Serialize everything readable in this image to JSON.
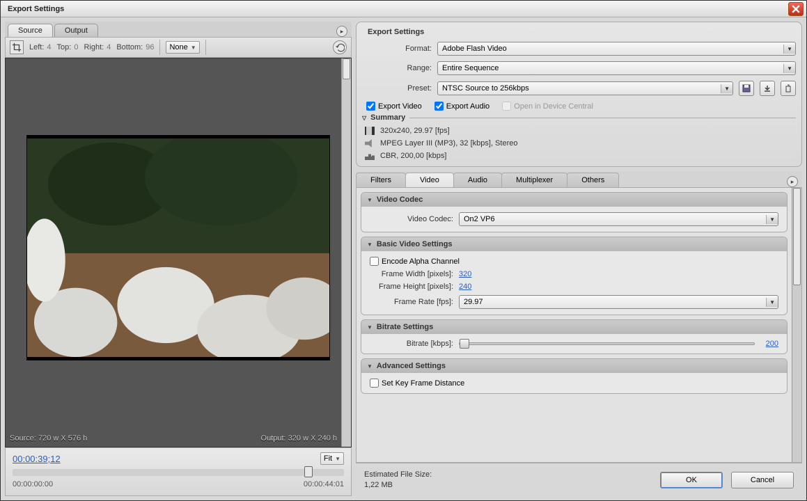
{
  "window": {
    "title": "Export Settings"
  },
  "leftTabs": {
    "source": "Source",
    "output": "Output"
  },
  "crop": {
    "leftLabel": "Left:",
    "leftVal": "4",
    "topLabel": "Top:",
    "topVal": "0",
    "rightLabel": "Right:",
    "rightVal": "4",
    "bottomLabel": "Bottom:",
    "bottomVal": "96",
    "aspect": "None"
  },
  "preview": {
    "sourceInfo": "Source: 720 w X 576 h",
    "outputInfo": "Output: 320 w X 240 h"
  },
  "timeline": {
    "timecode": "00:00:39;12",
    "fit": "Fit",
    "start": "00:00:00:00",
    "end": "00:00:44:01"
  },
  "exportSettings": {
    "heading": "Export Settings",
    "formatLabel": "Format:",
    "format": "Adobe Flash Video",
    "rangeLabel": "Range:",
    "range": "Entire Sequence",
    "presetLabel": "Preset:",
    "preset": "NTSC Source to 256kbps",
    "exportVideo": "Export Video",
    "exportAudio": "Export Audio",
    "openDevice": "Open in Device Central",
    "summaryLabel": "Summary",
    "summary": {
      "video": "320x240, 29.97 [fps]",
      "audio": "MPEG Layer III (MP3), 32 [kbps], Stereo",
      "bitrate": "CBR, 200,00 [kbps]"
    }
  },
  "tabs": {
    "filters": "Filters",
    "video": "Video",
    "audio": "Audio",
    "multiplexer": "Multiplexer",
    "others": "Others"
  },
  "videoCodec": {
    "heading": "Video Codec",
    "label": "Video Codec:",
    "value": "On2 VP6"
  },
  "basicVideo": {
    "heading": "Basic Video Settings",
    "encodeAlpha": "Encode Alpha Channel",
    "frameWidthLabel": "Frame Width [pixels]:",
    "frameWidth": "320",
    "frameHeightLabel": "Frame Height [pixels]:",
    "frameHeight": "240",
    "frameRateLabel": "Frame Rate [fps]:",
    "frameRate": "29.97"
  },
  "bitrateSettings": {
    "heading": "Bitrate Settings",
    "label": "Bitrate [kbps]:",
    "value": "200"
  },
  "advancedSettings": {
    "heading": "Advanced Settings",
    "setKeyFrame": "Set Key Frame Distance"
  },
  "footer": {
    "estLabel": "Estimated File Size:",
    "estValue": "1,22 MB",
    "ok": "OK",
    "cancel": "Cancel"
  }
}
